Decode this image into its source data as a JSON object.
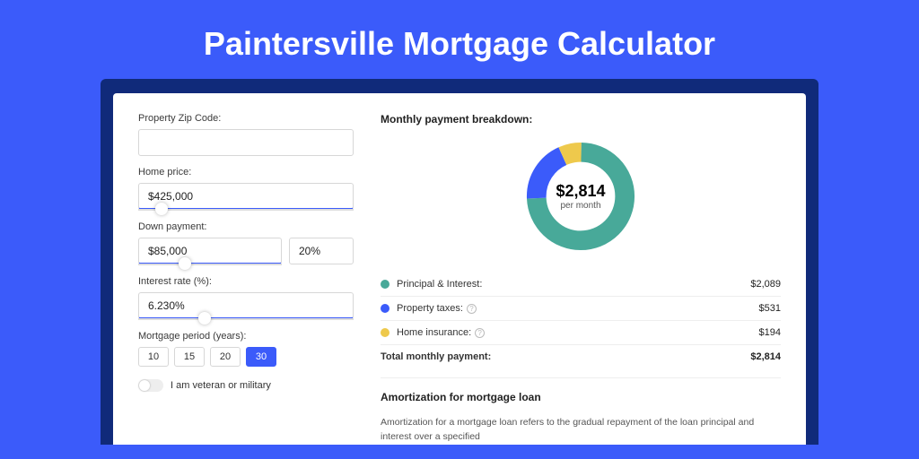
{
  "page_title": "Paintersville Mortgage Calculator",
  "form": {
    "zip": {
      "label": "Property Zip Code:",
      "value": ""
    },
    "home_price": {
      "label": "Home price:",
      "value": "$425,000",
      "slider_pos_pct": 8
    },
    "down_payment": {
      "label": "Down payment:",
      "value": "$85,000",
      "pct": "20%",
      "slider_pos_pct": 18
    },
    "interest_rate": {
      "label": "Interest rate (%):",
      "value": "6.230%",
      "slider_pos_pct": 28
    },
    "period": {
      "label": "Mortgage period (years):",
      "options": [
        "10",
        "15",
        "20",
        "30"
      ],
      "selected": "30"
    },
    "veteran": {
      "label": "I am veteran or military",
      "checked": false
    }
  },
  "breakdown": {
    "title": "Monthly payment breakdown:",
    "total_amount": "$2,814",
    "total_sub": "per month",
    "items": [
      {
        "label": "Principal & Interest:",
        "value": "$2,089",
        "color": "green",
        "info": false
      },
      {
        "label": "Property taxes:",
        "value": "$531",
        "color": "blue",
        "info": true
      },
      {
        "label": "Home insurance:",
        "value": "$194",
        "color": "yellow",
        "info": true
      }
    ],
    "total_row": {
      "label": "Total monthly payment:",
      "value": "$2,814"
    }
  },
  "amortization": {
    "title": "Amortization for mortgage loan",
    "text": "Amortization for a mortgage loan refers to the gradual repayment of the loan principal and interest over a specified"
  },
  "chart_data": {
    "type": "pie",
    "title": "Monthly payment breakdown",
    "series": [
      {
        "name": "Principal & Interest",
        "value": 2089,
        "color": "#48a999"
      },
      {
        "name": "Property taxes",
        "value": 531,
        "color": "#3b5bfa"
      },
      {
        "name": "Home insurance",
        "value": 194,
        "color": "#eec94c"
      }
    ],
    "total": 2814,
    "center_label": "$2,814 per month"
  }
}
